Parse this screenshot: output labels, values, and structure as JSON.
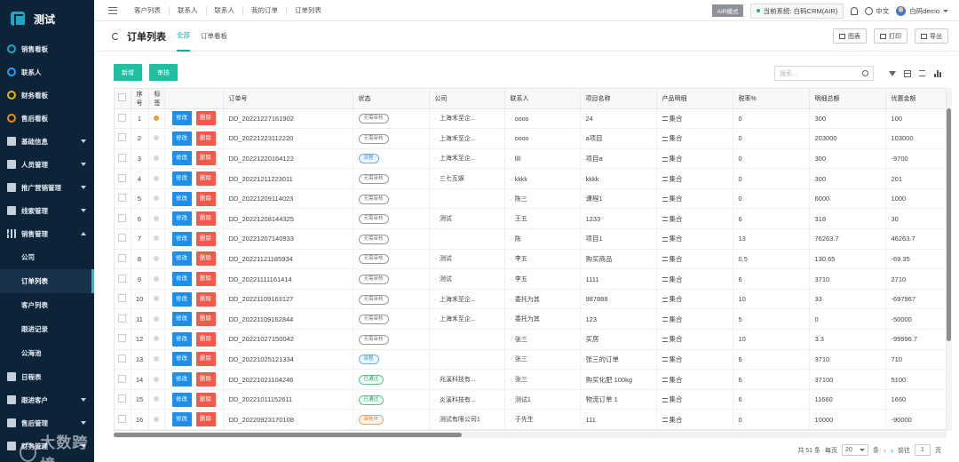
{
  "app": {
    "logo_text": "测试"
  },
  "sidebar": {
    "items": [
      {
        "label": "销售看板",
        "icon": "ring",
        "color": "#1ea7c5",
        "caret": ""
      },
      {
        "label": "联系人",
        "icon": "ring",
        "color": "#2e9bf0",
        "caret": ""
      },
      {
        "label": "财务看板",
        "icon": "ring",
        "color": "#f4b400",
        "caret": ""
      },
      {
        "label": "售后看板",
        "icon": "ring",
        "color": "#f08b1e",
        "caret": ""
      },
      {
        "label": "基础信息",
        "icon": "square",
        "caret": "down"
      },
      {
        "label": "人员管理",
        "icon": "square",
        "caret": "down"
      },
      {
        "label": "推广营销管理",
        "icon": "square",
        "caret": "down"
      },
      {
        "label": "线索管理",
        "icon": "square",
        "caret": "down"
      },
      {
        "label": "销售管理",
        "icon": "chart",
        "caret": "up"
      }
    ],
    "sub_items": [
      "公司",
      "订单列表",
      "客户列表",
      "跟进记录",
      "公海池"
    ],
    "active_sub": "订单列表",
    "bottom_items": [
      {
        "label": "日程表",
        "icon": "square",
        "caret": ""
      },
      {
        "label": "跟进客户",
        "icon": "square",
        "caret": "down"
      },
      {
        "label": "售后管理",
        "icon": "square",
        "caret": "down"
      },
      {
        "label": "财务管理",
        "icon": "square",
        "caret": "down"
      }
    ],
    "watermark": "大数跨境"
  },
  "topbar": {
    "breadcrumb_tabs": [
      "客户列表",
      "联系人",
      "联系人",
      "我的订单",
      "订单列表"
    ],
    "air_mode": "AIR模式",
    "current_system": "当前系统: 白码CRM(AIR)",
    "language": "中文",
    "user": "白码demo"
  },
  "page": {
    "title": "订单列表",
    "tabs": [
      "全部",
      "订单看板"
    ],
    "active_tab": "全部",
    "buttons": {
      "chart": "图表",
      "print": "打印",
      "export": "导出"
    }
  },
  "actions": {
    "add": "新增",
    "review": "审核",
    "search_placeholder": "搜索..."
  },
  "table": {
    "columns": [
      "序号",
      "标签",
      "",
      "订单号",
      "状态",
      "公司",
      "联系人",
      "项目名称",
      "产品明细",
      "税率%",
      "明细总额",
      "优惠金额"
    ],
    "edit_label": "修改",
    "delete_label": "删除",
    "detail_label": "集合",
    "rows": [
      {
        "no": "1",
        "tag": true,
        "order": "DD_20221227161902",
        "status": "无需审核",
        "status_color": "grey",
        "company": "上海禾至企...",
        "contact": "oooo",
        "project": "24",
        "tax": "0",
        "total": "300",
        "discount": "100"
      },
      {
        "no": "2",
        "tag": false,
        "order": "DD_20221223112220",
        "status": "无需审核",
        "status_color": "grey",
        "company": "上海禾至企...",
        "contact": "oooo",
        "project": "a项目",
        "tax": "0",
        "total": "203000",
        "discount": "103000"
      },
      {
        "no": "3",
        "tag": false,
        "order": "DD_20221220164122",
        "status": "流程",
        "status_color": "blue",
        "company": "上海禾至企...",
        "contact": "llll",
        "project": "项目a",
        "tax": "0",
        "total": "300",
        "discount": "-9700"
      },
      {
        "no": "4",
        "tag": false,
        "order": "DD_20221211223011",
        "status": "无需审核",
        "status_color": "grey",
        "company": "三七互娱",
        "contact": "kkkk",
        "project": "kkkk",
        "tax": "0",
        "total": "300",
        "discount": "201"
      },
      {
        "no": "5",
        "tag": false,
        "order": "DD_20221209114023",
        "status": "无需审核",
        "status_color": "grey",
        "company": "",
        "contact": "陈三",
        "project": "课程1",
        "tax": "0",
        "total": "6000",
        "discount": "1000"
      },
      {
        "no": "6",
        "tag": false,
        "order": "DD_20221208144325",
        "status": "无需审核",
        "status_color": "grey",
        "company": "测试",
        "contact": "王五",
        "project": "1233",
        "tax": "6",
        "total": "318",
        "discount": "30"
      },
      {
        "no": "7",
        "tag": false,
        "order": "DD_20221207140933",
        "status": "无需审核",
        "status_color": "grey",
        "company": "",
        "contact": "陈",
        "project": "项目1",
        "tax": "13",
        "total": "76263.7",
        "discount": "46263.7"
      },
      {
        "no": "8",
        "tag": false,
        "order": "DD_20221121185934",
        "status": "无需审核",
        "status_color": "grey",
        "company": "测试",
        "contact": "李五",
        "project": "购买商品",
        "tax": "0.5",
        "total": "130.65",
        "discount": "-69.35"
      },
      {
        "no": "9",
        "tag": false,
        "order": "DD_20221111161414",
        "status": "无需审核",
        "status_color": "grey",
        "company": "测试",
        "contact": "李五",
        "project": "1111",
        "tax": "6",
        "total": "3710",
        "discount": "2710"
      },
      {
        "no": "10",
        "tag": false,
        "order": "DD_20221109163127",
        "status": "无需审核",
        "status_color": "grey",
        "company": "上海禾至企...",
        "contact": "委托为其",
        "project": "987888",
        "tax": "10",
        "total": "33",
        "discount": "-697967"
      },
      {
        "no": "11",
        "tag": false,
        "order": "DD_20221109162844",
        "status": "无需审核",
        "status_color": "grey",
        "company": "上海禾至企...",
        "contact": "委托为其",
        "project": "123",
        "tax": "5",
        "total": "0",
        "discount": "-50000"
      },
      {
        "no": "12",
        "tag": false,
        "order": "DD_20221027150042",
        "status": "无需审核",
        "status_color": "grey",
        "company": "",
        "contact": "张三",
        "project": "买房",
        "tax": "10",
        "total": "3.3",
        "discount": "-99996.7"
      },
      {
        "no": "13",
        "tag": false,
        "order": "DD_20221025121334",
        "status": "流程",
        "status_color": "blue",
        "company": "",
        "contact": "张三",
        "project": "张三的订单",
        "tax": "6",
        "total": "3710",
        "discount": "710"
      },
      {
        "no": "14",
        "tag": false,
        "order": "DD_20221021104246",
        "status": "已通过",
        "status_color": "green",
        "company": "兆溪科技有...",
        "contact": "张三",
        "project": "购买化肥 100kg",
        "tax": "6",
        "total": "37100",
        "discount": "5100"
      },
      {
        "no": "15",
        "tag": false,
        "order": "DD_20221011152611",
        "status": "已通过",
        "status_color": "green",
        "company": "炎溪科技有...",
        "contact": "测试1",
        "project": "物流订单 1",
        "tax": "6",
        "total": "11660",
        "discount": "1660"
      },
      {
        "no": "16",
        "tag": false,
        "order": "DD_20220923170108",
        "status": "审核中",
        "status_color": "orange",
        "company": "测试有限公司1",
        "contact": "于先生",
        "project": "111",
        "tax": "0",
        "total": "10000",
        "discount": "-90000"
      }
    ]
  },
  "pagination": {
    "total": "共 51 条",
    "per_page_label": "每页",
    "per_page": "20",
    "unit": "条",
    "prev": "前往",
    "page": "1",
    "page_suffix": "页"
  }
}
